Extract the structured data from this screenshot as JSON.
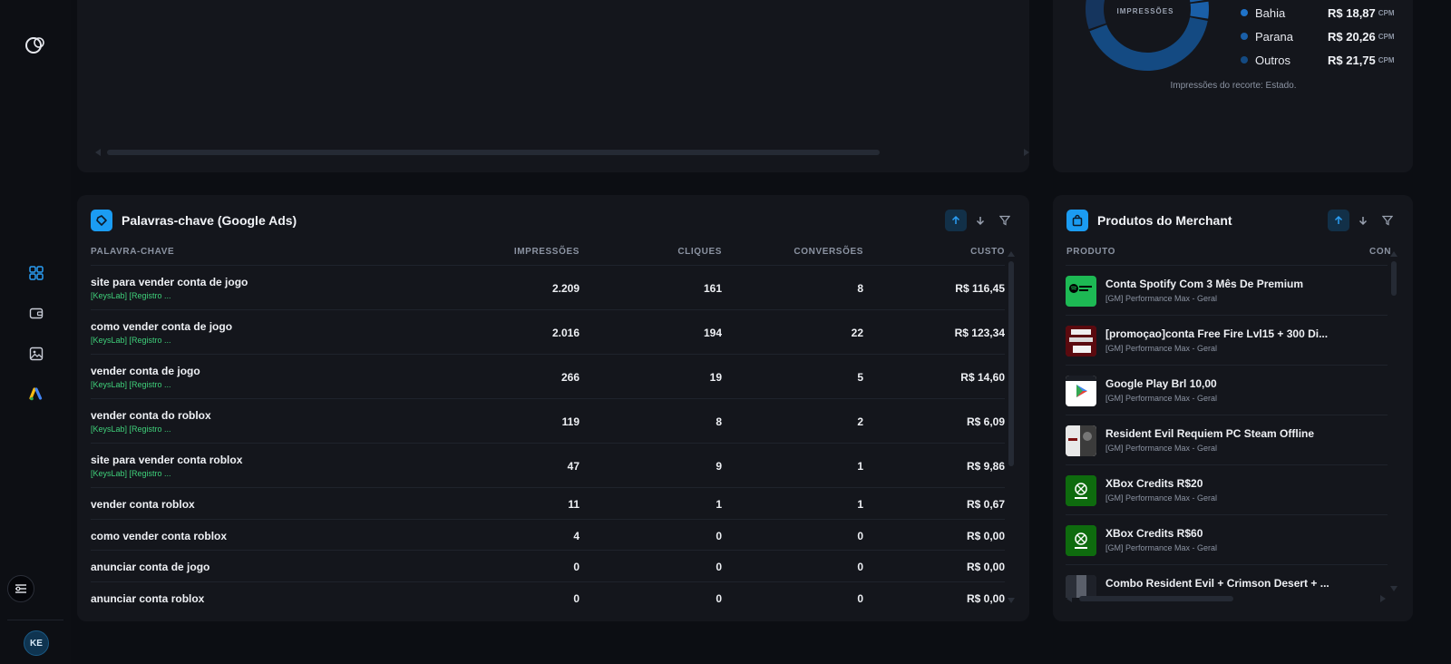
{
  "sidebar": {
    "logo_icon": "logo-icon",
    "nav": [
      {
        "name": "dashboard-grid-icon",
        "active": true
      },
      {
        "name": "wallet-icon",
        "active": false
      },
      {
        "name": "image-icon",
        "active": false
      },
      {
        "name": "google-ads-icon",
        "active": false
      }
    ],
    "avatar_initials": "KE"
  },
  "donut": {
    "label": "IMPRESSÕES",
    "legend": [
      {
        "name": "Bahia",
        "value": "R$ 18,87",
        "unit": "CPM",
        "color": "#1f73c9"
      },
      {
        "name": "Parana",
        "value": "R$ 20,26",
        "unit": "CPM",
        "color": "#1a5fa8"
      },
      {
        "name": "Outros",
        "value": "R$ 21,75",
        "unit": "CPM",
        "color": "#144a82"
      }
    ],
    "caption": "Impressões do recorte: Estado."
  },
  "keywords": {
    "title": "Palavras-chave (Google Ads)",
    "columns": [
      "PALAVRA-CHAVE",
      "IMPRESSÕES",
      "CLIQUES",
      "CONVERSÕES",
      "CUSTO"
    ],
    "rows": [
      {
        "keyword": "site para vender conta de jogo",
        "campaign": "[KeysLab] [Registro ...",
        "impressions": "2.209",
        "clicks": "161",
        "conversions": "8",
        "cost": "R$ 116,45"
      },
      {
        "keyword": "como vender conta de jogo",
        "campaign": "[KeysLab] [Registro ...",
        "impressions": "2.016",
        "clicks": "194",
        "conversions": "22",
        "cost": "R$ 123,34"
      },
      {
        "keyword": "vender conta de jogo",
        "campaign": "[KeysLab] [Registro ...",
        "impressions": "266",
        "clicks": "19",
        "conversions": "5",
        "cost": "R$ 14,60"
      },
      {
        "keyword": "vender conta do roblox",
        "campaign": "[KeysLab] [Registro ...",
        "impressions": "119",
        "clicks": "8",
        "conversions": "2",
        "cost": "R$ 6,09"
      },
      {
        "keyword": "site para vender conta roblox",
        "campaign": "[KeysLab] [Registro ...",
        "impressions": "47",
        "clicks": "9",
        "conversions": "1",
        "cost": "R$ 9,86"
      },
      {
        "keyword": "vender conta roblox",
        "campaign": "",
        "impressions": "11",
        "clicks": "1",
        "conversions": "1",
        "cost": "R$ 0,67"
      },
      {
        "keyword": "como vender conta roblox",
        "campaign": "",
        "impressions": "4",
        "clicks": "0",
        "conversions": "0",
        "cost": "R$ 0,00"
      },
      {
        "keyword": "anunciar conta de jogo",
        "campaign": "",
        "impressions": "0",
        "clicks": "0",
        "conversions": "0",
        "cost": "R$ 0,00"
      },
      {
        "keyword": "anunciar conta roblox",
        "campaign": "",
        "impressions": "0",
        "clicks": "0",
        "conversions": "0",
        "cost": "R$ 0,00"
      }
    ]
  },
  "merchant": {
    "title": "Produtos do Merchant",
    "columns": [
      "PRODUTO",
      "CON"
    ],
    "products": [
      {
        "name": "Conta Spotify Com 3 Mês De Premium",
        "campaign": "[GM] Performance Max - Geral",
        "thumb": "spotify-thumb",
        "thumb_color": "#1db954"
      },
      {
        "name": "[promoçao]conta Free Fire Lvl15 + 300 Di...",
        "campaign": "[GM] Performance Max - Geral",
        "thumb": "free-fire-thumb",
        "thumb_color": "#b3121b"
      },
      {
        "name": "Google Play Brl 10,00",
        "campaign": "[GM] Performance Max - Geral",
        "thumb": "google-play-thumb",
        "thumb_color": "#ffffff"
      },
      {
        "name": "Resident Evil Requiem PC Steam Offline",
        "campaign": "[GM] Performance Max - Geral",
        "thumb": "resident-evil-thumb",
        "thumb_color": "#d9d9d9"
      },
      {
        "name": "XBox Credits R$20",
        "campaign": "[GM] Performance Max - Geral",
        "thumb": "xbox-thumb",
        "thumb_color": "#107c10"
      },
      {
        "name": "XBox Credits R$60",
        "campaign": "[GM] Performance Max - Geral",
        "thumb": "xbox-thumb",
        "thumb_color": "#107c10"
      },
      {
        "name": "Combo Resident Evil + Crimson Desert + ...",
        "campaign": "",
        "thumb": "combo-thumb",
        "thumb_color": "#3a3f4a"
      }
    ]
  }
}
